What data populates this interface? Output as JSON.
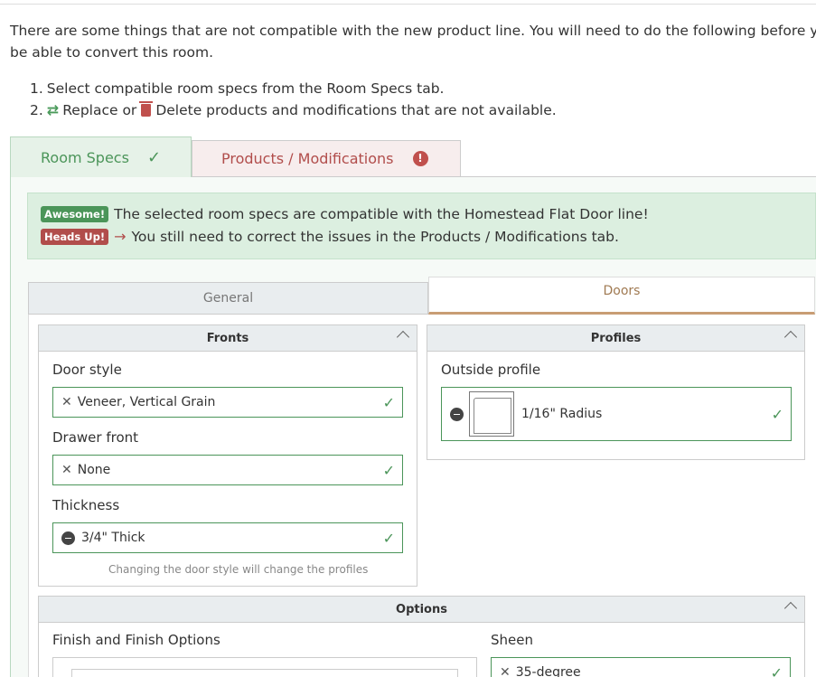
{
  "intro": {
    "line1": "There are some things that are not compatible with the new product line. You will need to do the following before you w",
    "line2": "be able to convert this room."
  },
  "steps": [
    {
      "num": "1.",
      "text": "Select compatible room specs from the Room Specs tab."
    },
    {
      "num": "2.",
      "replace_label": "Replace or",
      "text": "Delete products and modifications that are not available."
    }
  ],
  "tabs": {
    "room_specs": "Room Specs",
    "products": "Products / Modifications"
  },
  "alert": {
    "badge_ok": "Awesome!",
    "msg_ok": "The selected room specs are compatible with the Homestead Flat Door line!",
    "badge_warn": "Heads Up!",
    "msg_warn": "You still need to correct the issues in the Products / Modifications tab."
  },
  "subtabs": {
    "general": "General",
    "doors": "Doors"
  },
  "fronts": {
    "title": "Fronts",
    "door_style_label": "Door style",
    "door_style_value": "Veneer, Vertical Grain",
    "drawer_front_label": "Drawer front",
    "drawer_front_value": "None",
    "thickness_label": "Thickness",
    "thickness_value": "3/4\" Thick",
    "note": "Changing the door style will change the profiles"
  },
  "profiles": {
    "title": "Profiles",
    "outside_label": "Outside profile",
    "outside_value": "1/16\" Radius"
  },
  "options": {
    "title": "Options",
    "finish_label": "Finish and Finish Options",
    "sheen_label": "Sheen",
    "sheen_value": "35-degree"
  },
  "colors": {
    "success": "#4b9559",
    "danger": "#b14d4b",
    "doors_accent": "#c89d74"
  }
}
